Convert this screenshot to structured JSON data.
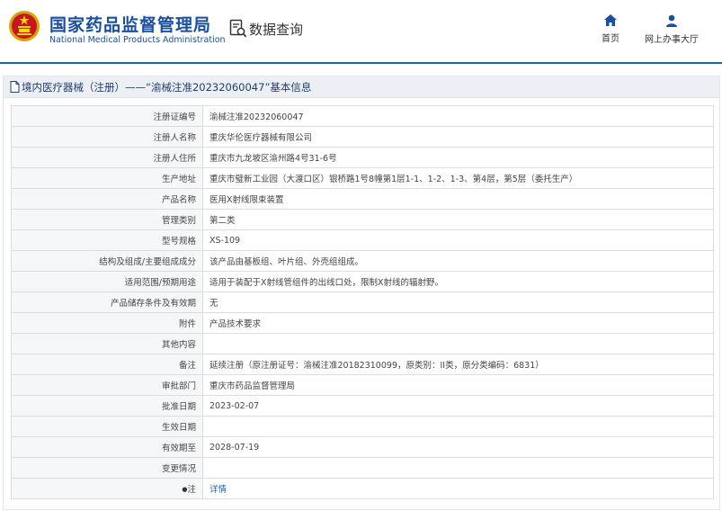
{
  "header": {
    "org_cn": "国家药品监督管理局",
    "org_en": "National Medical Products Administration",
    "query_title": "数据查询",
    "nav": {
      "home": "首页",
      "online_office": "网上办事大厅"
    },
    "brand_color": "#1a4fa0",
    "accent_color": "#1a62b4"
  },
  "breadcrumb": {
    "text": "境内医疗器械（注册）——“渝械注准20232060047”基本信息"
  },
  "record": {
    "rows": [
      {
        "label": "注册证编号",
        "value": "渝械注准20232060047"
      },
      {
        "label": "注册人名称",
        "value": "重庆华伦医疗器械有限公司"
      },
      {
        "label": "注册人住所",
        "value": "重庆市九龙坡区渝州路4号31-6号"
      },
      {
        "label": "生产地址",
        "value": "重庆市璧新工业园（大渡口区）银桥路1号8幢第1层1-1、1-2、1-3、第4层，第5层（委托生产）"
      },
      {
        "label": "产品名称",
        "value": "医用X射线限束装置"
      },
      {
        "label": "管理类别",
        "value": "第二类"
      },
      {
        "label": "型号规格",
        "value": "XS-109"
      },
      {
        "label": "结构及组成/主要组成成分",
        "value": "该产品由基板组、叶片组、外壳组组成。"
      },
      {
        "label": "适用范围/预期用途",
        "value": "适用于装配于X射线管组件的出线口处，限制X射线的辐射野。"
      },
      {
        "label": "产品储存条件及有效期",
        "value": "无"
      },
      {
        "label": "附件",
        "value": "产品技术要求"
      },
      {
        "label": "其他内容",
        "value": ""
      },
      {
        "label": "备注",
        "value": "延续注册（原注册证号：渝械注准20182310099，原类别：II类，原分类编码：6831）"
      },
      {
        "label": "审批部门",
        "value": "重庆市药品监督管理局"
      },
      {
        "label": "批准日期",
        "value": "2023-02-07"
      },
      {
        "label": "生效日期",
        "value": ""
      },
      {
        "label": "有效期至",
        "value": "2028-07-19"
      },
      {
        "label": "变更情况",
        "value": ""
      }
    ],
    "note": {
      "star": "●",
      "label": "注",
      "link": "详情"
    }
  }
}
